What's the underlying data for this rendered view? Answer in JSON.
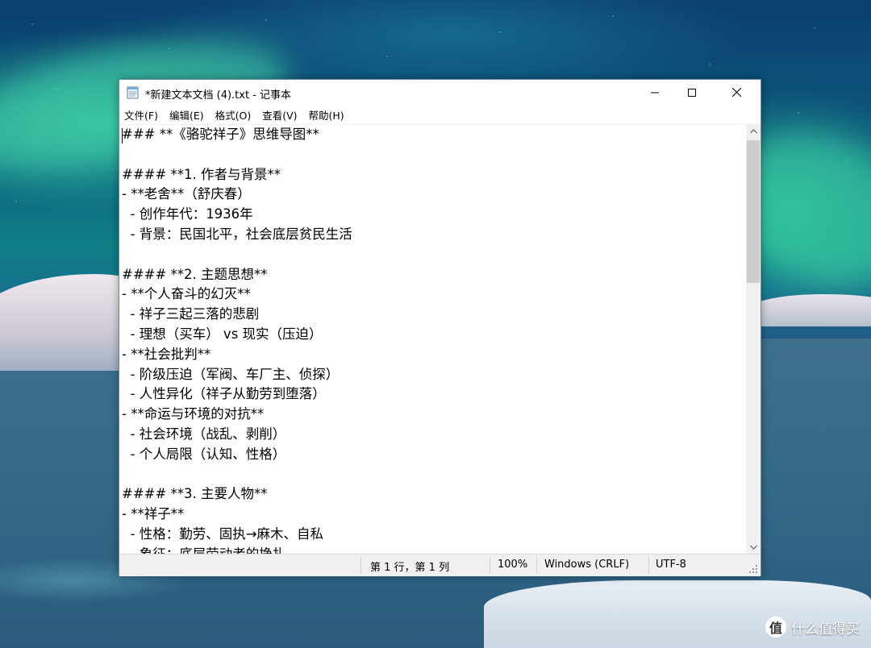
{
  "window": {
    "title": "*新建文本文档 (4).txt - 记事本"
  },
  "menu": {
    "items": [
      {
        "label": "文件(F)"
      },
      {
        "label": "编辑(E)"
      },
      {
        "label": "格式(O)"
      },
      {
        "label": "查看(V)"
      },
      {
        "label": "帮助(H)"
      }
    ]
  },
  "editor": {
    "content": "### **《骆驼祥子》思维导图**\n\n#### **1. 作者与背景**\n- **老舍**（舒庆春）\n  - 创作年代：1936年\n  - 背景：民国北平，社会底层贫民生活\n\n#### **2. 主题思想**\n- **个人奋斗的幻灭**\n  - 祥子三起三落的悲剧\n  - 理想（买车） vs 现实（压迫）\n- **社会批判**\n  - 阶级压迫（军阀、车厂主、侦探）\n  - 人性异化（祥子从勤劳到堕落）\n- **命运与环境的对抗**\n  - 社会环境（战乱、剥削）\n  - 个人局限（认知、性格）\n\n#### **3. 主要人物**\n- **祥子**\n  - 性格：勤劳、固执→麻木、自私\n  - 象征：底层劳动者的挣扎"
  },
  "status": {
    "position": "第 1 行，第 1 列",
    "zoom": "100%",
    "line_ending": "Windows (CRLF)",
    "encoding": "UTF-8"
  },
  "scrollbar": {
    "thumb_fraction": 0.36
  },
  "watermark": {
    "glyph": "值",
    "text": "什么值得买"
  }
}
